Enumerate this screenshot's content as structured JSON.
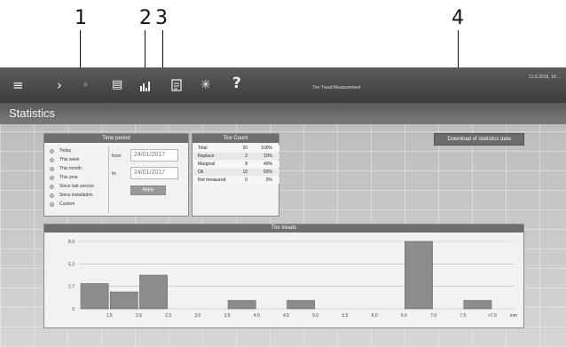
{
  "callouts": [
    "1",
    "2",
    "3",
    "4"
  ],
  "topbar": {
    "menu_icon": "menu-icon",
    "forward_icon": "chevron-right-icon",
    "title": "Tire Tread Measurement",
    "datetime": "21.5.2016, 10:..."
  },
  "page_title": "Statistics",
  "time_period": {
    "header": "Time period",
    "options": [
      "Today",
      "This week",
      "This month",
      "This year",
      "Since last service",
      "Since installation",
      "Custom"
    ],
    "from_label": "from:",
    "to_label": "to:",
    "from_value": "24/01/2017",
    "to_value": "24/01/2017",
    "apply_label": "Apply"
  },
  "tire_count": {
    "header": "Tire Count",
    "rows": [
      {
        "label": "Total",
        "count": "20",
        "pct": "100%"
      },
      {
        "label": "Replace",
        "count": "2",
        "pct": "10%"
      },
      {
        "label": "Marginal",
        "count": "8",
        "pct": "40%"
      },
      {
        "label": "Ok",
        "count": "10",
        "pct": "50%"
      },
      {
        "label": "Not measured",
        "count": "0",
        "pct": "0%"
      }
    ]
  },
  "download_label": "Download of statistics data",
  "tire_treads": {
    "header": "Tire treads",
    "unit": "mm"
  },
  "chart_data": {
    "type": "bar",
    "categories": [
      "1.0-1.5",
      "1.5-2.0",
      "2.0-2.5",
      "2.5-3.0",
      "3.0-3.5",
      "3.5-4.0",
      "4.0-4.5",
      "4.5-5.0",
      "5.0-5.5",
      "5.5-6.0",
      "6.0-6.5",
      "6.5-7.0",
      "7.0-7.5",
      "7.5-8.0"
    ],
    "values": [
      3,
      2,
      4,
      0,
      0,
      1,
      0,
      1,
      0,
      0,
      0,
      8,
      0,
      1
    ],
    "x_ticks": [
      "1.5",
      "2.0",
      "2.5",
      "3.0",
      "3.5",
      "4.0",
      "4.5",
      "5.0",
      "5.5",
      "6.0",
      "6.5",
      "7.0",
      "7.5",
      ">7.5"
    ],
    "y_ticks": [
      "0",
      "2.7",
      "5.3",
      "8.0"
    ],
    "ylim": [
      0,
      8
    ],
    "xlabel": "mm",
    "ylabel": "",
    "title": "Tire treads",
    "grid": true
  }
}
